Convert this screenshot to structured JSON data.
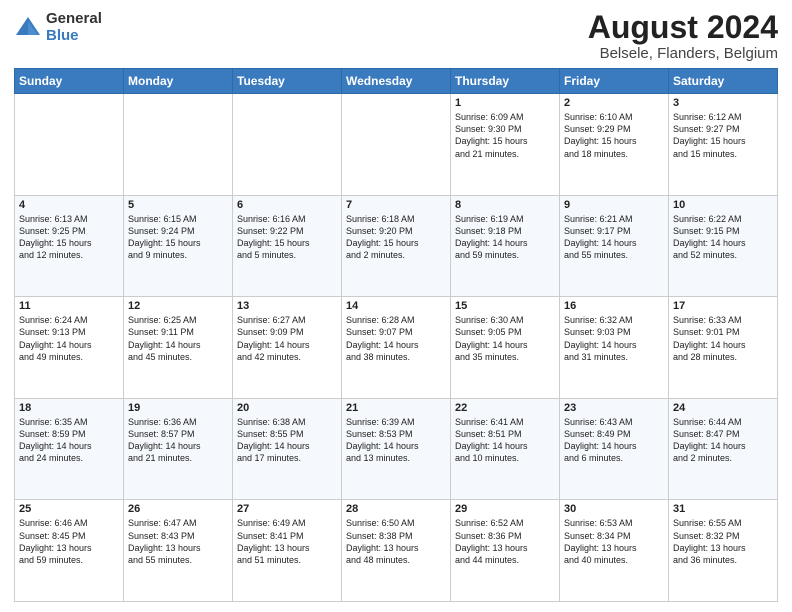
{
  "logo": {
    "line1": "General",
    "line2": "Blue"
  },
  "title": "August 2024",
  "subtitle": "Belsele, Flanders, Belgium",
  "days_of_week": [
    "Sunday",
    "Monday",
    "Tuesday",
    "Wednesday",
    "Thursday",
    "Friday",
    "Saturday"
  ],
  "weeks": [
    [
      {
        "day": "",
        "info": ""
      },
      {
        "day": "",
        "info": ""
      },
      {
        "day": "",
        "info": ""
      },
      {
        "day": "",
        "info": ""
      },
      {
        "day": "1",
        "info": "Sunrise: 6:09 AM\nSunset: 9:30 PM\nDaylight: 15 hours\nand 21 minutes."
      },
      {
        "day": "2",
        "info": "Sunrise: 6:10 AM\nSunset: 9:29 PM\nDaylight: 15 hours\nand 18 minutes."
      },
      {
        "day": "3",
        "info": "Sunrise: 6:12 AM\nSunset: 9:27 PM\nDaylight: 15 hours\nand 15 minutes."
      }
    ],
    [
      {
        "day": "4",
        "info": "Sunrise: 6:13 AM\nSunset: 9:25 PM\nDaylight: 15 hours\nand 12 minutes."
      },
      {
        "day": "5",
        "info": "Sunrise: 6:15 AM\nSunset: 9:24 PM\nDaylight: 15 hours\nand 9 minutes."
      },
      {
        "day": "6",
        "info": "Sunrise: 6:16 AM\nSunset: 9:22 PM\nDaylight: 15 hours\nand 5 minutes."
      },
      {
        "day": "7",
        "info": "Sunrise: 6:18 AM\nSunset: 9:20 PM\nDaylight: 15 hours\nand 2 minutes."
      },
      {
        "day": "8",
        "info": "Sunrise: 6:19 AM\nSunset: 9:18 PM\nDaylight: 14 hours\nand 59 minutes."
      },
      {
        "day": "9",
        "info": "Sunrise: 6:21 AM\nSunset: 9:17 PM\nDaylight: 14 hours\nand 55 minutes."
      },
      {
        "day": "10",
        "info": "Sunrise: 6:22 AM\nSunset: 9:15 PM\nDaylight: 14 hours\nand 52 minutes."
      }
    ],
    [
      {
        "day": "11",
        "info": "Sunrise: 6:24 AM\nSunset: 9:13 PM\nDaylight: 14 hours\nand 49 minutes."
      },
      {
        "day": "12",
        "info": "Sunrise: 6:25 AM\nSunset: 9:11 PM\nDaylight: 14 hours\nand 45 minutes."
      },
      {
        "day": "13",
        "info": "Sunrise: 6:27 AM\nSunset: 9:09 PM\nDaylight: 14 hours\nand 42 minutes."
      },
      {
        "day": "14",
        "info": "Sunrise: 6:28 AM\nSunset: 9:07 PM\nDaylight: 14 hours\nand 38 minutes."
      },
      {
        "day": "15",
        "info": "Sunrise: 6:30 AM\nSunset: 9:05 PM\nDaylight: 14 hours\nand 35 minutes."
      },
      {
        "day": "16",
        "info": "Sunrise: 6:32 AM\nSunset: 9:03 PM\nDaylight: 14 hours\nand 31 minutes."
      },
      {
        "day": "17",
        "info": "Sunrise: 6:33 AM\nSunset: 9:01 PM\nDaylight: 14 hours\nand 28 minutes."
      }
    ],
    [
      {
        "day": "18",
        "info": "Sunrise: 6:35 AM\nSunset: 8:59 PM\nDaylight: 14 hours\nand 24 minutes."
      },
      {
        "day": "19",
        "info": "Sunrise: 6:36 AM\nSunset: 8:57 PM\nDaylight: 14 hours\nand 21 minutes."
      },
      {
        "day": "20",
        "info": "Sunrise: 6:38 AM\nSunset: 8:55 PM\nDaylight: 14 hours\nand 17 minutes."
      },
      {
        "day": "21",
        "info": "Sunrise: 6:39 AM\nSunset: 8:53 PM\nDaylight: 14 hours\nand 13 minutes."
      },
      {
        "day": "22",
        "info": "Sunrise: 6:41 AM\nSunset: 8:51 PM\nDaylight: 14 hours\nand 10 minutes."
      },
      {
        "day": "23",
        "info": "Sunrise: 6:43 AM\nSunset: 8:49 PM\nDaylight: 14 hours\nand 6 minutes."
      },
      {
        "day": "24",
        "info": "Sunrise: 6:44 AM\nSunset: 8:47 PM\nDaylight: 14 hours\nand 2 minutes."
      }
    ],
    [
      {
        "day": "25",
        "info": "Sunrise: 6:46 AM\nSunset: 8:45 PM\nDaylight: 13 hours\nand 59 minutes."
      },
      {
        "day": "26",
        "info": "Sunrise: 6:47 AM\nSunset: 8:43 PM\nDaylight: 13 hours\nand 55 minutes."
      },
      {
        "day": "27",
        "info": "Sunrise: 6:49 AM\nSunset: 8:41 PM\nDaylight: 13 hours\nand 51 minutes."
      },
      {
        "day": "28",
        "info": "Sunrise: 6:50 AM\nSunset: 8:38 PM\nDaylight: 13 hours\nand 48 minutes."
      },
      {
        "day": "29",
        "info": "Sunrise: 6:52 AM\nSunset: 8:36 PM\nDaylight: 13 hours\nand 44 minutes."
      },
      {
        "day": "30",
        "info": "Sunrise: 6:53 AM\nSunset: 8:34 PM\nDaylight: 13 hours\nand 40 minutes."
      },
      {
        "day": "31",
        "info": "Sunrise: 6:55 AM\nSunset: 8:32 PM\nDaylight: 13 hours\nand 36 minutes."
      }
    ]
  ]
}
